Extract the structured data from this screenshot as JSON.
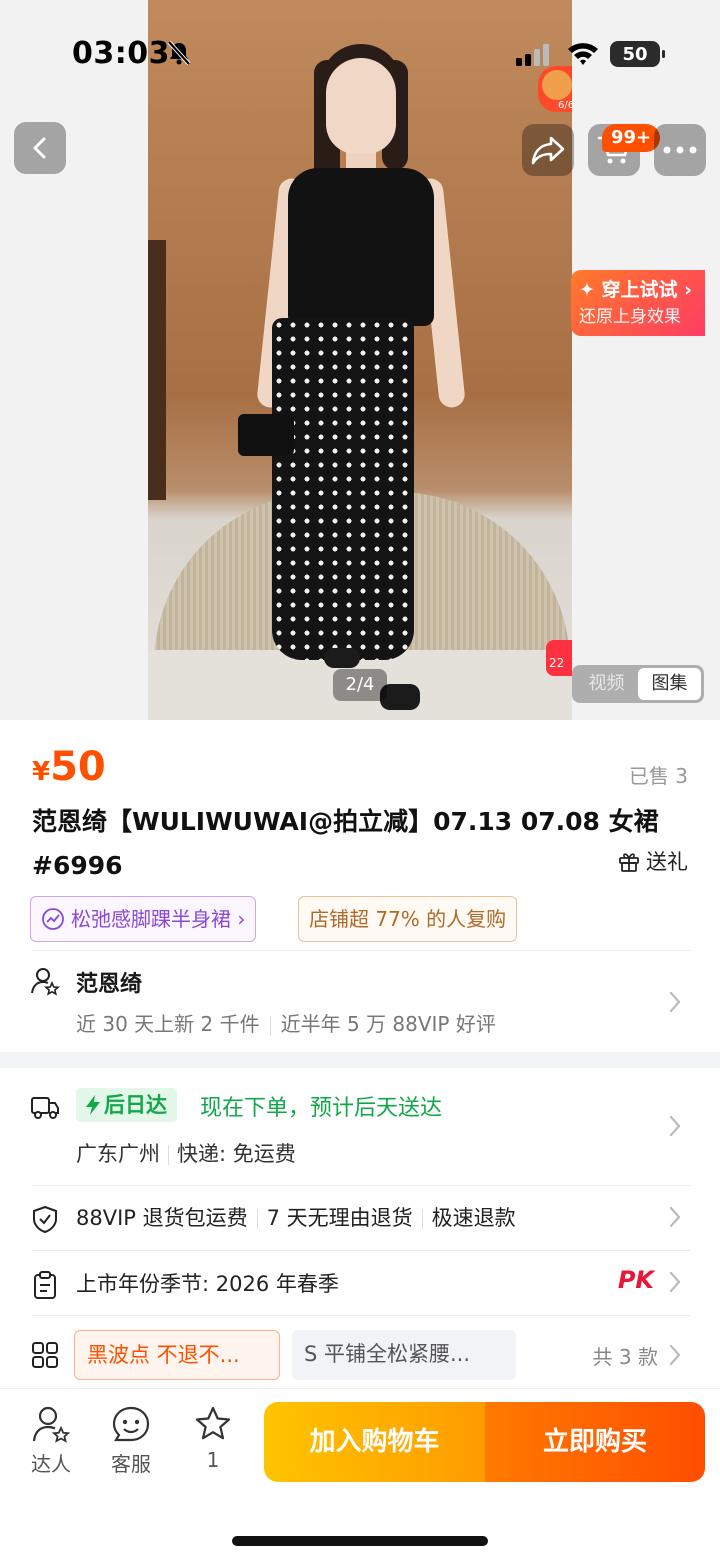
{
  "status_bar": {
    "time": "03:03",
    "battery": "50"
  },
  "header": {
    "cart_badge": "99+"
  },
  "live": {
    "count": "6/6"
  },
  "tryon": {
    "title": "✦ 穿上试试 ›",
    "subtitle": "还原上身效果"
  },
  "gallery": {
    "counter": "2/4",
    "tabs": [
      "视频",
      "图集"
    ],
    "active_tab": "图集",
    "sticker": "22"
  },
  "product": {
    "price_symbol": "¥",
    "price": "50",
    "sold": "已售 3",
    "title": "范恩绮【WULIWUWAI@拍立减】07.13 07.08 女裙#6996",
    "gift": "送礼",
    "tags": {
      "rank": "松弛感脚踝半身裙 ›",
      "repurchase": "店铺超 77% 的人复购"
    }
  },
  "store": {
    "name": "范恩绮",
    "stat_new": "近 30 天上新 2 千件",
    "stat_review": "近半年 5 万 88VIP 好评"
  },
  "delivery": {
    "badge": "后日达",
    "text": "现在下单，预计后天送达",
    "origin": "广东广州",
    "shipping": "快递: 免运费"
  },
  "services": {
    "items": [
      "88VIP 退货包运费",
      "7 天无理由退货",
      "极速退款"
    ]
  },
  "attributes": {
    "text": "上市年份季节: 2026 年春季",
    "pk": "PK"
  },
  "sku": {
    "options": [
      "黑波点 不退不...",
      "S 平铺全松紧腰..."
    ],
    "count": "共 3 款"
  },
  "bottom_bar": {
    "daren": "达人",
    "service": "客服",
    "favorites": "1",
    "add_to_cart": "加入购物车",
    "buy_now": "立即购买"
  },
  "colors": {
    "accent": "#ff5000",
    "delivery_green": "#11a84a",
    "cart_yellow": "#ffb000",
    "buy_orange": "#ff5a00"
  }
}
